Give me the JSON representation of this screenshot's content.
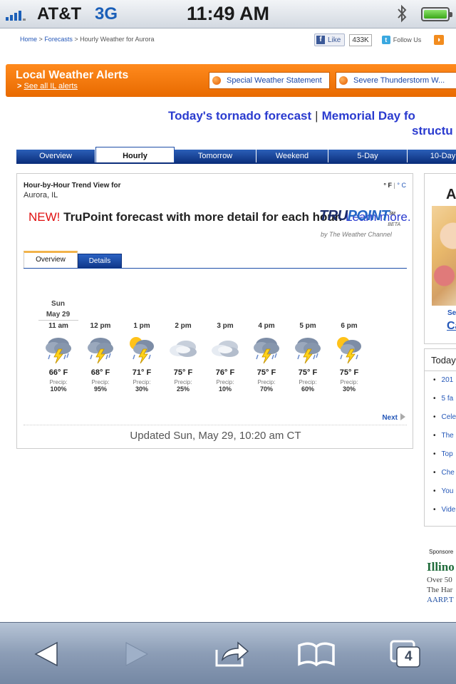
{
  "status": {
    "carrier": "AT&T",
    "network": "3G",
    "time": "11:49 AM"
  },
  "breadcrumb": {
    "home": "Home",
    "forecasts": "Forecasts",
    "current": "Hourly Weather for Aurora",
    "sep": ">"
  },
  "social": {
    "like_label": "Like",
    "like_count": "433K",
    "follow_label": "Follow Us"
  },
  "alerts": {
    "title": "Local Weather Alerts",
    "see_all_prefix": ">",
    "see_all": "See all IL alerts",
    "items": [
      "Special Weather Statement",
      "Severe Thunderstorm W..."
    ]
  },
  "headlines": {
    "first": "Today's tornado forecast",
    "separator": "|",
    "second": "Memorial Day fo",
    "second_line2": "structu"
  },
  "main_tabs": [
    "Overview",
    "Hourly",
    "Tomorrow",
    "Weekend",
    "5-Day",
    "10-Day"
  ],
  "panel": {
    "title": "Hour-by-Hour Trend View for",
    "location": "Aurora, IL",
    "unit_f": "° F",
    "unit_sep": "|",
    "unit_c": "° C",
    "promo_new": "NEW!",
    "promo_text": "TruPoint forecast with more detail for each hour.",
    "promo_link": "Learn more.",
    "logo_tru": "TRU",
    "logo_point": "POINT",
    "logo_sm": "SM",
    "logo_beta": "BETA",
    "logo_sub": "by The Weather Channel",
    "inner_tabs": [
      "Overview",
      "Details"
    ],
    "day_name": "Sun",
    "day_date": "May 29",
    "precip_label": "Precip:",
    "next": "Next",
    "updated": "Updated Sun, May 29, 10:20 am CT"
  },
  "hours": [
    {
      "time": "11 am",
      "temp": "66° F",
      "precip": "100%",
      "icon": "thunderstorm-icon"
    },
    {
      "time": "12 pm",
      "temp": "68° F",
      "precip": "95%",
      "icon": "thunderstorm-icon"
    },
    {
      "time": "1 pm",
      "temp": "71° F",
      "precip": "30%",
      "icon": "sun-thunderstorm-icon"
    },
    {
      "time": "2 pm",
      "temp": "75° F",
      "precip": "25%",
      "icon": "cloudy-icon"
    },
    {
      "time": "3 pm",
      "temp": "76° F",
      "precip": "10%",
      "icon": "cloudy-icon"
    },
    {
      "time": "4 pm",
      "temp": "75° F",
      "precip": "70%",
      "icon": "thunderstorm-icon"
    },
    {
      "time": "5 pm",
      "temp": "75° F",
      "precip": "60%",
      "icon": "thunderstorm-icon"
    },
    {
      "time": "6 pm",
      "temp": "75° F",
      "precip": "30%",
      "icon": "sun-thunderstorm-icon"
    }
  ],
  "side": {
    "ad_letter": "A",
    "ad_se": "Se",
    "ad_ca": "Ca",
    "list_title": "Today",
    "list_items": [
      "201",
      "5 fa",
      "Cele",
      "The",
      "Top",
      "Che",
      "You",
      "Vide"
    ],
    "sponsored": "Sponsore",
    "illinois_title": "Illino",
    "illinois_lines": [
      "Over 50",
      "The Har"
    ],
    "illinois_link": "AARP.T"
  },
  "toolbar": {
    "tab_count": "4"
  },
  "colors": {
    "accent_blue": "#1d4ea8",
    "alert_orange": "#f07a10",
    "link": "#2a3bcf"
  }
}
